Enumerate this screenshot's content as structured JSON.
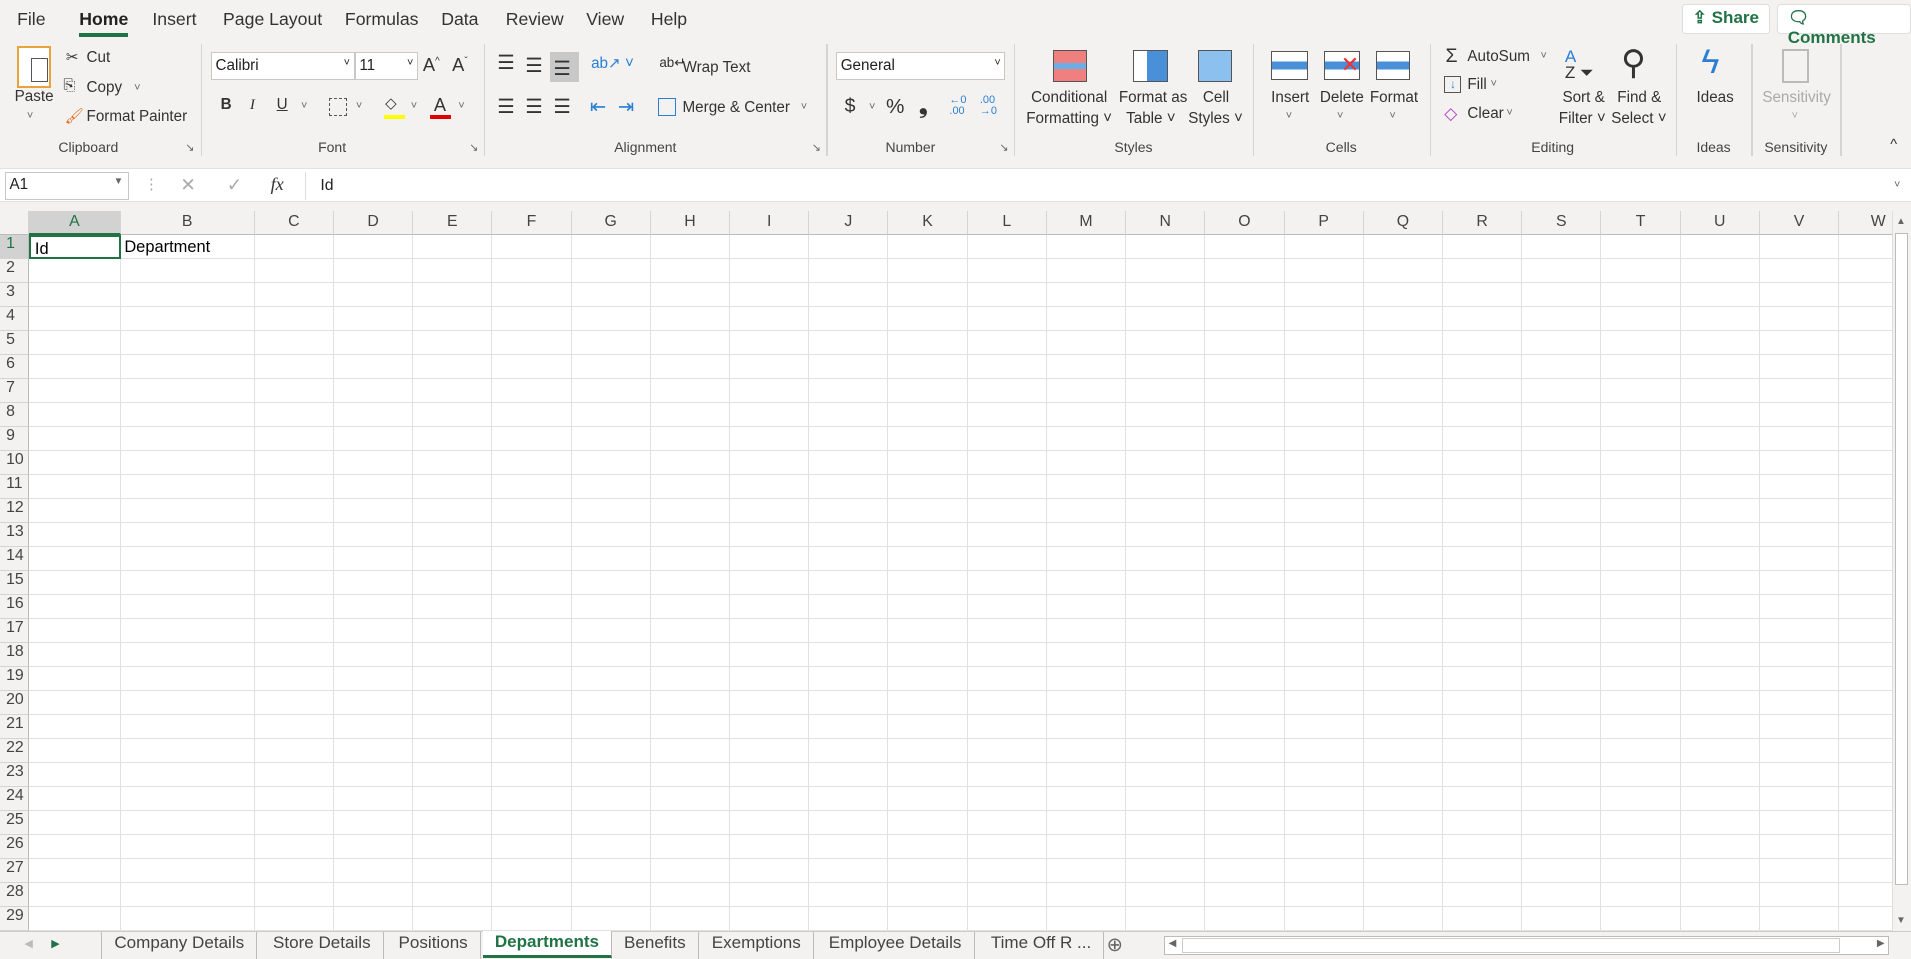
{
  "menu": {
    "items": [
      "File",
      "Home",
      "Insert",
      "Page Layout",
      "Formulas",
      "Data",
      "Review",
      "View",
      "Help"
    ],
    "active": "Home",
    "share": "Share",
    "comments": "Comments"
  },
  "ribbon": {
    "clipboard": {
      "label": "Clipboard",
      "paste": "Paste",
      "cut": "Cut",
      "copy": "Copy",
      "format_painter": "Format Painter"
    },
    "font": {
      "label": "Font",
      "name": "Calibri",
      "size": "11",
      "bold": "B",
      "italic": "I",
      "underline": "U",
      "font_color": "#e00000",
      "fill_color": "#ffff00"
    },
    "alignment": {
      "label": "Alignment",
      "wrap_text": "Wrap Text",
      "merge_center": "Merge & Center"
    },
    "number": {
      "label": "Number",
      "format": "General",
      "currency": "$",
      "percent": "%",
      "comma": "❟",
      "inc_decimal": "←0 .00",
      "dec_decimal": ".00 →0"
    },
    "styles": {
      "label": "Styles",
      "conditional": [
        "Conditional",
        "Formatting ˅"
      ],
      "format_table": [
        "Format as",
        "Table ˅"
      ],
      "cell_styles": [
        "Cell",
        "Styles ˅"
      ]
    },
    "cells": {
      "label": "Cells",
      "insert": "Insert",
      "delete": "Delete",
      "format": "Format"
    },
    "editing": {
      "label": "Editing",
      "autosum": "AutoSum",
      "fill": "Fill",
      "clear": "Clear",
      "sort": [
        "Sort &",
        "Filter ˅"
      ],
      "find": [
        "Find &",
        "Select ˅"
      ]
    },
    "ideas": {
      "label": "Ideas",
      "button": "Ideas"
    },
    "sensitivity": {
      "label": "Sensitivity",
      "button": "Sensitivity"
    }
  },
  "formula_bar": {
    "name_box": "A1",
    "fx": "fx",
    "value": "Id"
  },
  "grid": {
    "columns": [
      "A",
      "B",
      "C",
      "D",
      "E",
      "F",
      "G",
      "H",
      "I",
      "J",
      "K",
      "L",
      "M",
      "N",
      "O",
      "P",
      "Q",
      "R",
      "S",
      "T",
      "U",
      "V",
      "W"
    ],
    "rows": [
      "1",
      "2",
      "3",
      "4",
      "5",
      "6",
      "7",
      "8",
      "9",
      "10",
      "11",
      "12",
      "13",
      "14",
      "15",
      "16",
      "17",
      "18",
      "19",
      "20",
      "21",
      "22",
      "23",
      "24",
      "25",
      "26",
      "27",
      "28",
      "29"
    ],
    "cells": [
      {
        "ref": "A1",
        "value": "Id"
      },
      {
        "ref": "B1",
        "value": "Department"
      }
    ],
    "selected": "A1"
  },
  "sheets": {
    "tabs": [
      "Company Details",
      "Store Details",
      "Positions",
      "Departments",
      "Benefits",
      "Exemptions",
      "Employee Details",
      "Time Off R ..."
    ],
    "active": "Departments"
  }
}
